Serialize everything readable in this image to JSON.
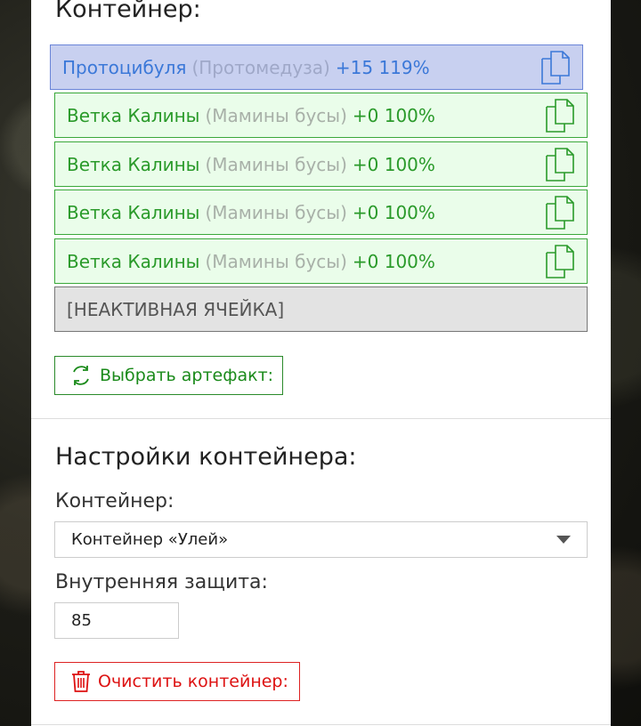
{
  "container_section": {
    "title": "Контейнер:",
    "cells": [
      {
        "name": "Протоцибуля",
        "alt": "(Протомедуза)",
        "bonus": "+15 119%",
        "state": "active"
      },
      {
        "name": "Ветка Калины",
        "alt": "(Мамины бусы)",
        "bonus": "+0 100%",
        "state": "filled"
      },
      {
        "name": "Ветка Калины",
        "alt": "(Мамины бусы)",
        "bonus": "+0 100%",
        "state": "filled"
      },
      {
        "name": "Ветка Калины",
        "alt": "(Мамины бусы)",
        "bonus": "+0 100%",
        "state": "filled"
      },
      {
        "name": "Ветка Калины",
        "alt": "(Мамины бусы)",
        "bonus": "+0 100%",
        "state": "filled"
      }
    ],
    "inactive_cell_label": "[НЕАКТИВНАЯ ЯЧЕЙКА]",
    "select_artifact_button": "Выбрать артефакт:",
    "copy_icon": "copy-icon",
    "refresh_icon": "refresh-icon"
  },
  "settings_section": {
    "title": "Настройки контейнера:",
    "container_label": "Контейнер:",
    "container_selected": "Контейнер «Улей»",
    "protection_label": "Внутренняя защита:",
    "protection_value": "85",
    "clear_button": "Очистить контейнер:",
    "trash_icon": "trash-icon"
  },
  "colors": {
    "active_cell_bg": "#c8d0f0",
    "filled_cell_bg": "#eafdea",
    "accent_green": "#1a8a1a",
    "accent_red": "#dd1111",
    "accent_blue": "#3b78d8"
  }
}
